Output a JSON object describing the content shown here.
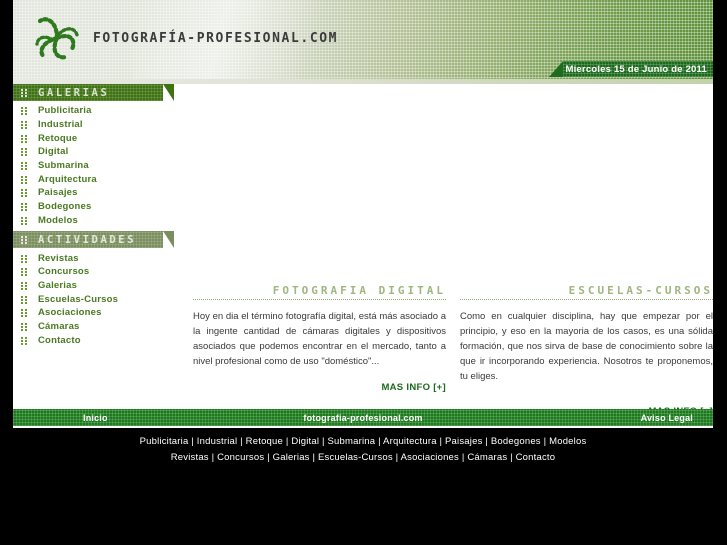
{
  "site": {
    "brand": "FOTOGRAFÍA-PROFESIONAL.COM",
    "logo_icon": "spiral-pinwheel-logo",
    "date": "Miercoles 15 de Junio de 2011",
    "accent_green": "#3f7212",
    "olive_green": "#7b8f5e",
    "bright_green": "#1b7a1b",
    "link_green": "#4a7a22"
  },
  "sidebar": {
    "sections": [
      {
        "title": "GALERIAS",
        "items": [
          {
            "label": "Publicitaria"
          },
          {
            "label": "Industrial"
          },
          {
            "label": "Retoque"
          },
          {
            "label": "Digital"
          },
          {
            "label": "Submarina"
          },
          {
            "label": "Arquitectura"
          },
          {
            "label": "Paisajes"
          },
          {
            "label": "Bodegones"
          },
          {
            "label": "Modelos"
          }
        ]
      },
      {
        "title": "ACTIVIDADES",
        "items": [
          {
            "label": "Revistas"
          },
          {
            "label": "Concursos"
          },
          {
            "label": "Galerias"
          },
          {
            "label": "Escuelas-Cursos"
          },
          {
            "label": "Asociaciones"
          },
          {
            "label": "Cámaras"
          },
          {
            "label": "Contacto"
          }
        ]
      }
    ]
  },
  "main": {
    "columns": [
      {
        "heading": "FOTOGRAFIA DIGITAL",
        "body": "Hoy en dia el término fotografía digital, está más asociado a la ingente cantidad de cámaras digitales y dispositivos asociados que podemos encontrar en el mercado, tanto a nivel profesional como de uso \"doméstico\"...",
        "more": "MAS INFO [+]"
      },
      {
        "heading": "ESCUELAS-CURSOS",
        "body": "Como en cualquier disciplina, hay que empezar por el principio, y eso en la mayoria de los casos, es una sólida formación, que nos sirva de base de conocimiento sobre la que ir incorporando experiencia. Nosotros te proponemos, tu eliges.",
        "more": "MAS INFO [+]"
      }
    ]
  },
  "footer": {
    "bar": {
      "home": "Inicio",
      "center": "fotografia-profesional.com",
      "legal": "Aviso Legal"
    },
    "row1": "Publicitaria | Industrial | Retoque | Digital | Submarina | Arquitectura | Paisajes | Bodegones | Modelos",
    "row2": "Revistas | Concursos | Galerias | Escuelas-Cursos | Asociaciones | Cámaras | Contacto"
  }
}
